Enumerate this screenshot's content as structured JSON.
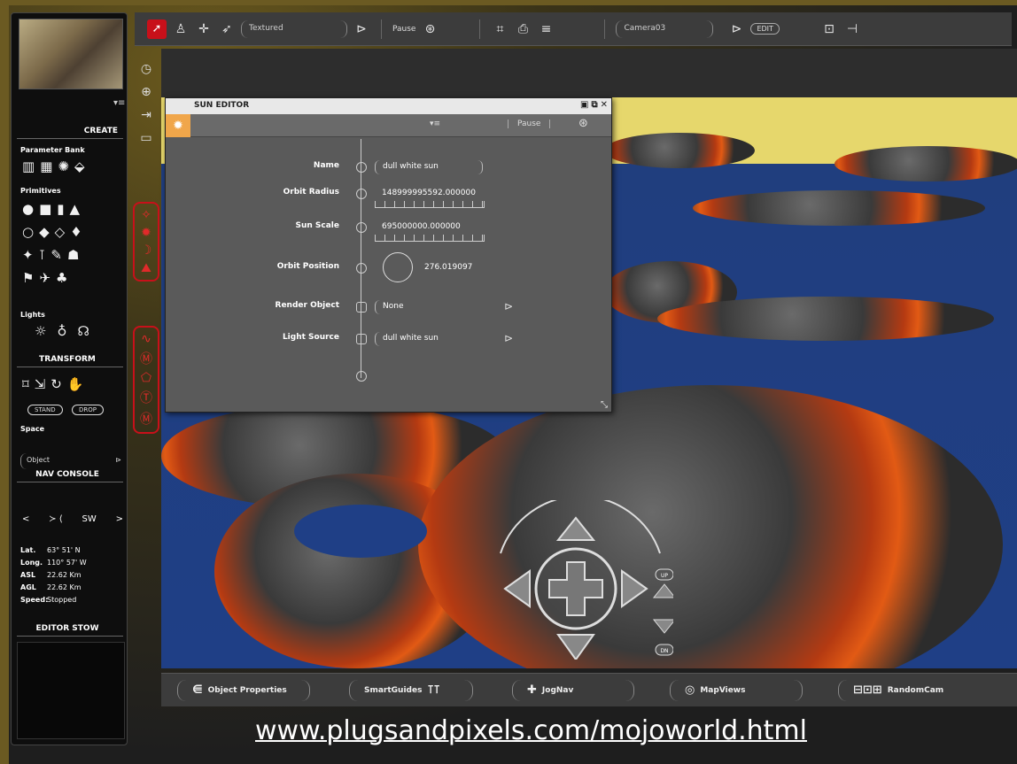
{
  "toolbar": {
    "mode": "Textured",
    "pause": "Pause",
    "camera": "Camera03",
    "edit": "EDIT"
  },
  "left": {
    "create": "CREATE",
    "param_bank": "Parameter Bank",
    "primitives": "Primitives",
    "lights": "Lights",
    "transform": "TRANSFORM",
    "btn_stand": "STAND",
    "btn_drop": "DROP",
    "space": "Space",
    "space_value": "Object",
    "nav_console": "NAV CONSOLE",
    "compass_left": "<",
    "compass_dir": "SW",
    "compass_right": ">",
    "stats": [
      {
        "k": "Lat.",
        "v": "63° 51' N"
      },
      {
        "k": "Long.",
        "v": "110° 57' W"
      },
      {
        "k": "ASL",
        "v": "22.62 Km"
      },
      {
        "k": "AGL",
        "v": "22.62 Km"
      },
      {
        "k": "Speed:",
        "v": "Stopped"
      }
    ],
    "editor_stow": "EDITOR STOW"
  },
  "dialog": {
    "title": "SUN EDITOR",
    "pause": "Pause",
    "name_label": "Name",
    "name_value": "dull white sun",
    "orbit_radius_label": "Orbit Radius",
    "orbit_radius_value": "148999995592.000000",
    "sun_scale_label": "Sun Scale",
    "sun_scale_value": "695000000.000000",
    "orbit_position_label": "Orbit Position",
    "orbit_position_value": "276.019097",
    "render_object_label": "Render Object",
    "render_object_value": "None",
    "light_source_label": "Light Source",
    "light_source_value": "dull white sun"
  },
  "bottom": {
    "object_properties": "Object Properties",
    "smart_guides": "SmartGuides",
    "joggle": "JogNav",
    "map_views": "MapViews",
    "random_cam": "RandomCam"
  },
  "nav": {
    "up": "UP",
    "down": "DN"
  },
  "url": "www.plugsandpixels.com/mojoworld.html"
}
